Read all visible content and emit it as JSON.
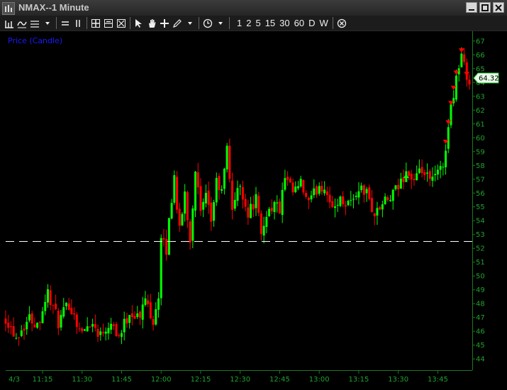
{
  "window": {
    "title": "NMAX--1 Minute"
  },
  "toolbar": {
    "icons": [
      "bar-chart-icon",
      "line-chart-icon",
      "compare-icon",
      "dropdown-arrow-icon",
      "horizontal-lines-icon",
      "vertical-lines-icon",
      "grid-icon",
      "split-icon",
      "clear-icon",
      "pointer-icon",
      "hand-icon",
      "crosshair-icon",
      "pencil-icon",
      "dropdown-arrow-icon",
      "clock-icon",
      "dropdown-arrow-icon",
      "close-circle-icon"
    ],
    "timeframes": [
      "1",
      "2",
      "5",
      "15",
      "30",
      "60",
      "D",
      "W"
    ]
  },
  "colors": {
    "background": "#000000",
    "axis_text": "#1fa32e",
    "up_candle": "#00ff00",
    "down_candle": "#ff0000",
    "title_text": "#1a1aff",
    "reference_line": "#ffffff",
    "price_tag_bg": "#e8ffe8"
  },
  "chart_data": {
    "type": "candlestick",
    "title": "Price (Candle)",
    "symbol": "NMAX",
    "interval": "1 Minute",
    "date_label": "4/3",
    "x_tick_labels": [
      "11:15",
      "11:30",
      "11:45",
      "12:00",
      "12:15",
      "12:30",
      "12:45",
      "13:00",
      "13:15",
      "13:30",
      "13:45"
    ],
    "x_range": [
      "11:01",
      "13:57"
    ],
    "y_tick_labels": [
      "44",
      "45",
      "46",
      "47",
      "48",
      "49",
      "50",
      "51",
      "52",
      "53",
      "54",
      "55",
      "56",
      "57",
      "58",
      "59",
      "60",
      "61",
      "62",
      "63",
      "64",
      "65",
      "66",
      "67"
    ],
    "ylim": [
      43.6,
      67.4
    ],
    "last_price": "64.32",
    "reference_line_price": 52.5,
    "grid": false,
    "anchors": [
      [
        "11:01",
        47.0
      ],
      [
        "11:05",
        45.6
      ],
      [
        "11:10",
        47.0
      ],
      [
        "11:13",
        46.5
      ],
      [
        "11:17",
        48.8
      ],
      [
        "11:21",
        46.6
      ],
      [
        "11:25",
        48.0
      ],
      [
        "11:30",
        45.8
      ],
      [
        "11:33",
        46.7
      ],
      [
        "11:37",
        45.8
      ],
      [
        "11:41",
        46.8
      ],
      [
        "11:44",
        45.6
      ],
      [
        "11:48",
        47.4
      ],
      [
        "11:52",
        47.0
      ],
      [
        "11:54",
        48.4
      ],
      [
        "11:57",
        46.8
      ],
      [
        "11:59",
        48.6
      ],
      [
        "12:00",
        52.6
      ],
      [
        "12:02",
        51.8
      ],
      [
        "12:03",
        54.0
      ],
      [
        "12:05",
        57.2
      ],
      [
        "12:07",
        53.2
      ],
      [
        "12:09",
        56.0
      ],
      [
        "12:11",
        52.6
      ],
      [
        "12:13",
        57.8
      ],
      [
        "12:15",
        54.5
      ],
      [
        "12:17",
        55.6
      ],
      [
        "12:19",
        54.0
      ],
      [
        "12:21",
        56.8
      ],
      [
        "12:23",
        56.0
      ],
      [
        "12:25",
        59.2
      ],
      [
        "12:27",
        55.0
      ],
      [
        "12:30",
        56.6
      ],
      [
        "12:33",
        54.5
      ],
      [
        "12:36",
        55.6
      ],
      [
        "12:38",
        52.8
      ],
      [
        "12:40",
        54.6
      ],
      [
        "12:43",
        55.2
      ],
      [
        "12:45",
        54.8
      ],
      [
        "12:47",
        57.0
      ],
      [
        "12:50",
        56.0
      ],
      [
        "12:53",
        56.6
      ],
      [
        "12:56",
        55.2
      ],
      [
        "13:00",
        56.6
      ],
      [
        "13:03",
        56.2
      ],
      [
        "13:05",
        54.6
      ],
      [
        "13:07",
        55.5
      ],
      [
        "13:10",
        55.4
      ],
      [
        "13:13",
        55.5
      ],
      [
        "13:15",
        56.4
      ],
      [
        "13:18",
        56.0
      ],
      [
        "13:21",
        54.4
      ],
      [
        "13:24",
        55.2
      ],
      [
        "13:27",
        55.6
      ],
      [
        "13:30",
        56.4
      ],
      [
        "13:33",
        57.6
      ],
      [
        "13:36",
        56.8
      ],
      [
        "13:39",
        57.6
      ],
      [
        "13:42",
        56.8
      ],
      [
        "13:45",
        57.4
      ],
      [
        "13:47",
        58.0
      ],
      [
        "13:48",
        59.4
      ],
      [
        "13:50",
        62.2
      ],
      [
        "13:52",
        64.4
      ],
      [
        "13:54",
        66.0
      ],
      [
        "13:56",
        64.3
      ]
    ],
    "markers": {
      "down_arrows_at": [
        "13:48",
        "13:49",
        "13:50",
        "13:51",
        "13:52",
        "13:54",
        "13:56"
      ],
      "up_arrows_at": [
        "13:33"
      ]
    }
  }
}
